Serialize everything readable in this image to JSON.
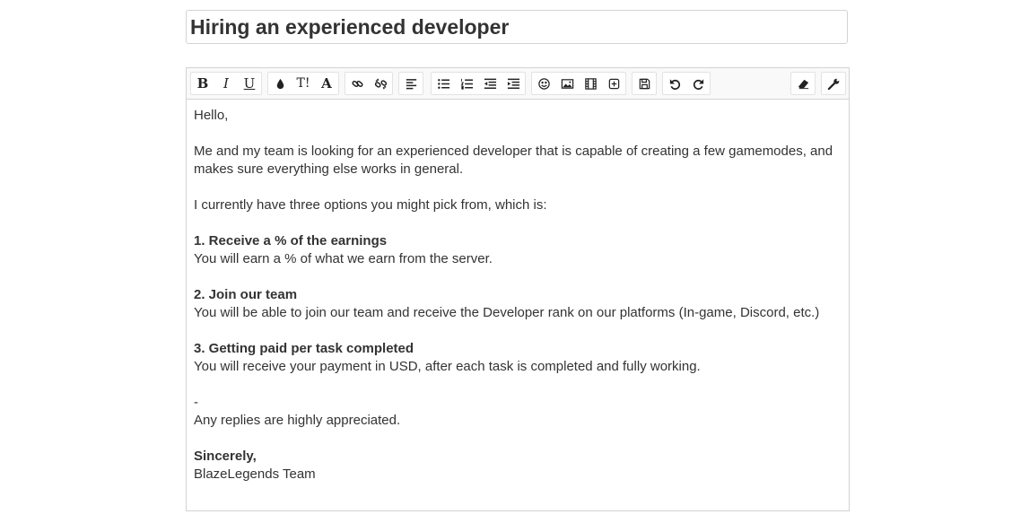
{
  "title": {
    "value": "Hiring an experienced developer"
  },
  "toolbar": {
    "bold": "B",
    "italic": "I",
    "underline": "U",
    "font_size": "T!",
    "font_family": "A"
  },
  "content": {
    "greeting": "Hello,",
    "intro": "Me and my team is looking for an experienced developer that is capable of creating a few gamemodes, and makes sure everything else works in general.",
    "options_intro": "I currently have three options you might pick from, which is:",
    "option1_title": "1. Receive a % of the earnings",
    "option1_text": "You will earn a % of what we earn from the server.",
    "option2_title": "2. Join our team",
    "option2_text": "You will be able to join our team and receive the Developer rank on our platforms (In-game, Discord, etc.)",
    "option3_title": "3. Getting paid per task completed",
    "option3_text": "You will receive your payment in USD, after each task is completed and fully working.",
    "separator": "-",
    "closing": "Any replies are highly appreciated.",
    "signoff": "Sincerely,",
    "signature": "BlazeLegends Team"
  }
}
